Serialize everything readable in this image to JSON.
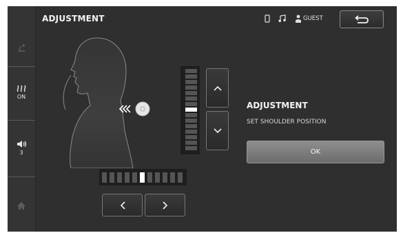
{
  "header": {
    "title": "ADJUSTMENT",
    "user": "GUEST"
  },
  "sidebar": {
    "heat": {
      "icon": "heat-wave-icon",
      "label": "ON"
    },
    "volume": {
      "icon": "speaker-icon",
      "label": "3"
    },
    "top_icon": "seat-recline-icon",
    "home_icon": "home-icon"
  },
  "status_icons": [
    "phone-icon",
    "music-note-icon",
    "user-icon"
  ],
  "panel": {
    "title": "ADJUSTMENT",
    "subtitle": "SET SHOULDER POSITION",
    "ok_label": "OK"
  },
  "vertical_position": {
    "segments": 15,
    "selected_index": 7
  },
  "horizontal_position": {
    "segments": 11,
    "selected_index": 5
  },
  "colors": {
    "background": "#2f2f2f",
    "accent": "#ffffff",
    "segment": "#555555",
    "ok_button": "#7a7a7a"
  }
}
